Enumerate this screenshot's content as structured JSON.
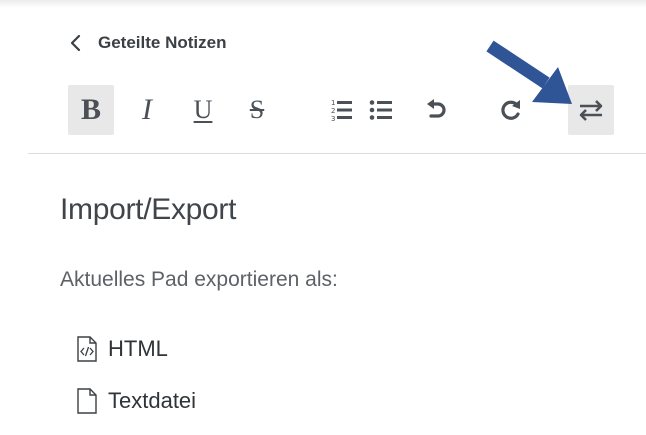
{
  "header": {
    "back_label": "Geteilte Notizen"
  },
  "toolbar": {
    "bold_glyph": "B",
    "italic_glyph": "I",
    "underline_glyph": "U",
    "strike_glyph": "S",
    "buttons": [
      {
        "name": "bold",
        "icon": "bold-icon",
        "active": true
      },
      {
        "name": "italic",
        "icon": "italic-icon",
        "active": false
      },
      {
        "name": "underline",
        "icon": "underline-icon",
        "active": false
      },
      {
        "name": "strikethrough",
        "icon": "strikethrough-icon",
        "active": false
      },
      {
        "name": "ordered-list",
        "icon": "ordered-list-icon",
        "active": false
      },
      {
        "name": "unordered-list",
        "icon": "unordered-list-icon",
        "active": false
      },
      {
        "name": "undo",
        "icon": "undo-icon",
        "active": false
      },
      {
        "name": "redo",
        "icon": "redo-icon",
        "active": false
      },
      {
        "name": "import-export",
        "icon": "import-export-icon",
        "active": true
      }
    ]
  },
  "annotation": {
    "arrow_color": "#2f5597",
    "points_to": "import-export-button"
  },
  "panel": {
    "title": "Import/Export",
    "subtitle": "Aktuelles Pad exportieren als:",
    "options": [
      {
        "label": "HTML",
        "icon": "html-file-icon"
      },
      {
        "label": "Textdatei",
        "icon": "text-file-icon"
      }
    ]
  },
  "colors": {
    "active_button_bg": "#e8e8e8",
    "icon_color": "#4a5056",
    "text_dark": "#3f454b",
    "divider": "#d9dcdf"
  }
}
